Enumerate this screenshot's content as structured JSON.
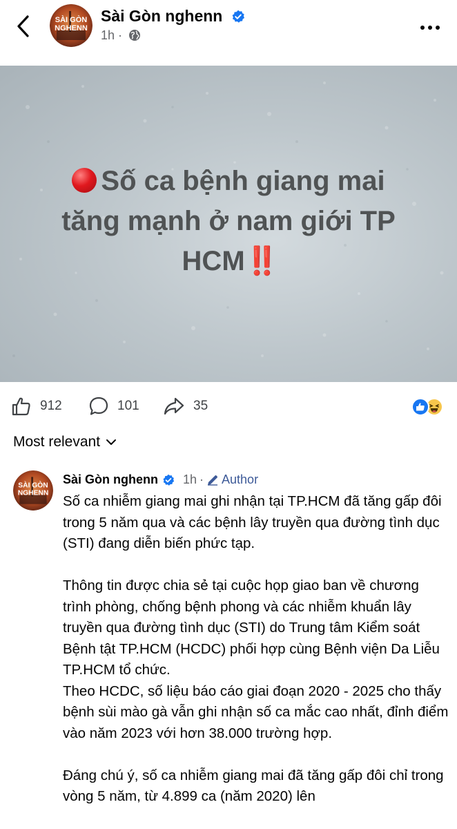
{
  "header": {
    "page_name": "Sài Gòn nghenn",
    "time": "1h",
    "avatar_text": [
      "SÀI GÒN",
      "NGHENN"
    ]
  },
  "post_image": {
    "line1": "Số ca bệnh giang mai",
    "line2": "tăng mạnh ở nam giới TP",
    "line3": "HCM",
    "emphasis": "‼️"
  },
  "stats": {
    "likes": "912",
    "comments": "101",
    "shares": "35"
  },
  "sort": {
    "label": "Most relevant"
  },
  "comment": {
    "author": "Sài Gòn nghenn",
    "time": "1h",
    "separator": "·",
    "badge": "Author",
    "paragraphs": [
      "Số ca nhiễm giang mai ghi nhận tại TP.HCM đã tăng gấp đôi trong 5 năm qua và các bệnh lây truyền qua đường tình dục (STI) đang diễn biến phức tạp.",
      "Thông tin được chia sẻ tại cuộc họp giao ban về chương trình phòng, chống bệnh phong và các nhiễm khuẩn lây truyền qua đường tình dục (STI) do Trung tâm Kiểm soát Bệnh tật TP.HCM (HCDC) phối hợp cùng Bệnh viện Da Liễu TP.HCM tổ chức.",
      "Theo HCDC, số liệu báo cáo giai đoạn 2020 - 2025 cho thấy bệnh sùi mào gà vẫn ghi nhận số ca mắc cao nhất, đỉnh điểm vào năm 2023 với hơn 38.000 trường hợp.",
      "Đáng chú ý, số ca nhiễm giang mai đã tăng gấp đôi chỉ trong vòng 5 năm, từ 4.899 ca (năm 2020) lên"
    ]
  },
  "colors": {
    "verified_blue": "#1877f2",
    "meta_gray": "#65676b",
    "author_badge": "#3d5a98",
    "alert_red": "#e0181e"
  }
}
